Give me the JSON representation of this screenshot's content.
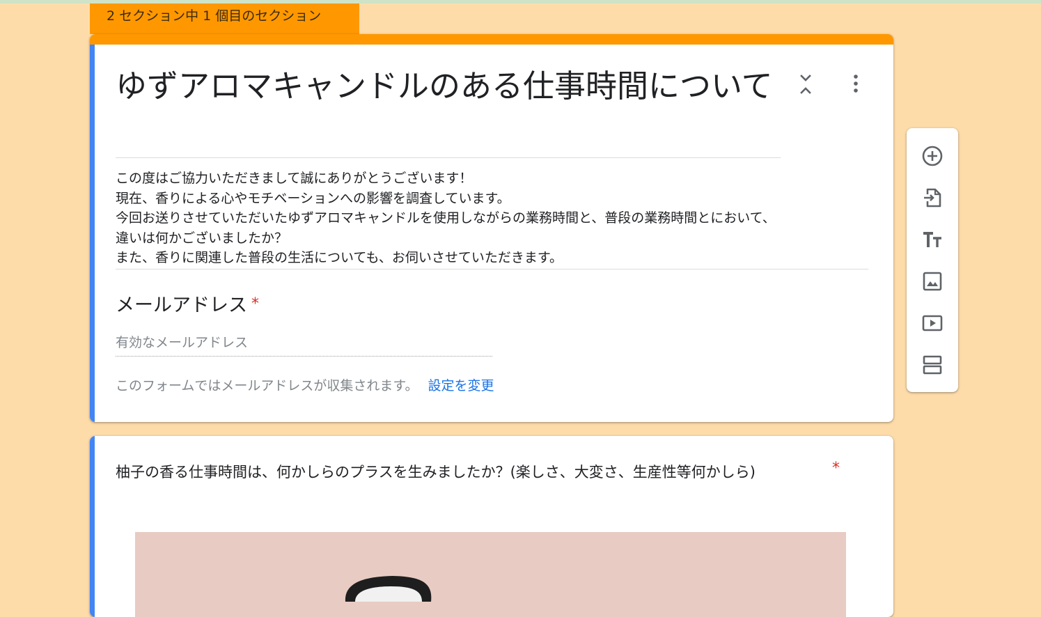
{
  "section_tab": {
    "label": "2 セクション中 1 個目のセクション"
  },
  "form": {
    "title": "ゆずアロマキャンドルのある仕事時間について",
    "description_lines": [
      "この度はご協力いただきまして誠にありがとうございます！",
      "現在、香りによる心やモチベーションへの影響を調査しています。",
      "今回お送りさせていただいたゆずアロマキャンドルを使用しながらの業務時間と、普段の業務時間とにおいて、",
      "違いは何かございましたか？",
      "また、香りに関連した普段の生活についても、お伺いさせていただきます。"
    ]
  },
  "email_question": {
    "label": "メールアドレス",
    "required_mark": "*",
    "placeholder": "有効なメールアドレス",
    "value": "",
    "collect_note": "このフォームではメールアドレスが収集されます。",
    "change_settings_link": "設定を変更"
  },
  "question2": {
    "text": "柚子の香る仕事時間は、何かしらのプラスを生みましたか？(楽しさ、大変さ、生産性等何かしら)",
    "required_mark": "*"
  },
  "toolbar": {
    "icons": [
      "add-question-icon",
      "import-questions-icon",
      "add-title-icon",
      "add-image-icon",
      "add-video-icon",
      "add-section-icon"
    ]
  },
  "colors": {
    "background": "#fddcaa",
    "accent_orange": "#ff9800",
    "focus_blue": "#4285f4",
    "required_red": "#d93025",
    "link_blue": "#1a73e8"
  }
}
